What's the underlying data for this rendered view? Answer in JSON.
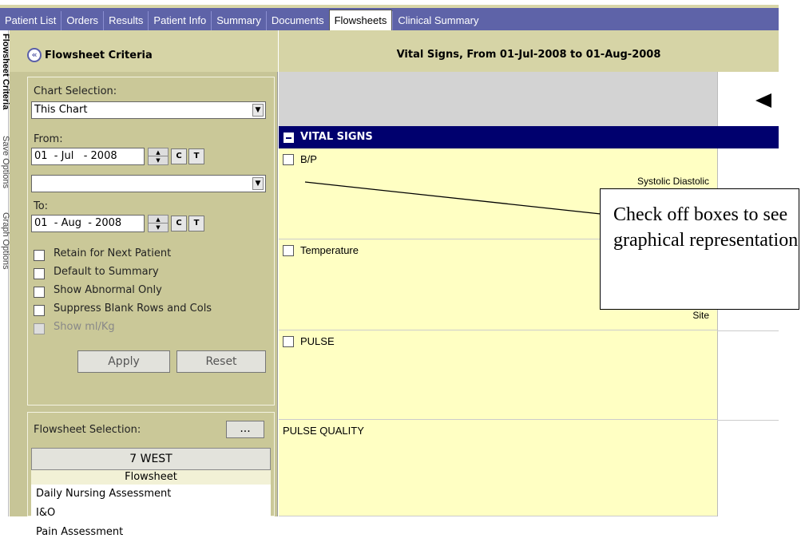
{
  "tabs": [
    {
      "label": "Patient List",
      "active": false
    },
    {
      "label": "Orders",
      "active": false
    },
    {
      "label": "Results",
      "active": false
    },
    {
      "label": "Patient Info",
      "active": false
    },
    {
      "label": "Summary",
      "active": false
    },
    {
      "label": "Documents",
      "active": false
    },
    {
      "label": "Flowsheets",
      "active": true
    },
    {
      "label": "Clinical Summary",
      "active": false
    }
  ],
  "side_tabs": [
    "Flowsheet Criteria",
    "Save Options",
    "Graph Options"
  ],
  "left_panel": {
    "title": "Flowsheet Criteria",
    "chart_selection_label": "Chart Selection:",
    "chart_selection_value": "This Chart",
    "from_label": "From:",
    "from_date": "01  - Jul   - 2008",
    "to_label": "To:",
    "to_date": "01  - Aug  - 2008",
    "c_btn": "C",
    "t_btn": "T",
    "options": [
      {
        "label": "Retain for Next Patient",
        "checked": false,
        "disabled": false
      },
      {
        "label": "Default to Summary",
        "checked": false,
        "disabled": false
      },
      {
        "label": "Show Abnormal Only",
        "checked": false,
        "disabled": false
      },
      {
        "label": "Suppress Blank Rows and Cols",
        "checked": false,
        "disabled": false
      },
      {
        "label": "Show ml/Kg",
        "checked": false,
        "disabled": true
      }
    ],
    "apply_label": "Apply",
    "reset_label": "Reset",
    "flowsheet_selection_label": "Flowsheet Selection:",
    "ellipsis_label": "...",
    "flowsheet_group": "7 WEST",
    "flowsheet_col": "Flowsheet",
    "flowsheets": [
      "Daily Nursing Assessment",
      "I&O",
      "Pain Assessment"
    ]
  },
  "right_panel": {
    "header": "Vital Signs, From 01-Jul-2008 to 01-Aug-2008",
    "section": "VITAL SIGNS",
    "rows": [
      {
        "label": "B/P",
        "sub": "Systolic Diastolic"
      },
      {
        "label": "Temperature",
        "sub": "Site"
      },
      {
        "label": "PULSE",
        "sub": ""
      },
      {
        "label": "PULSE QUALITY",
        "sub": ""
      }
    ]
  },
  "callout": {
    "text": "Check off boxes to see graphical representation"
  }
}
